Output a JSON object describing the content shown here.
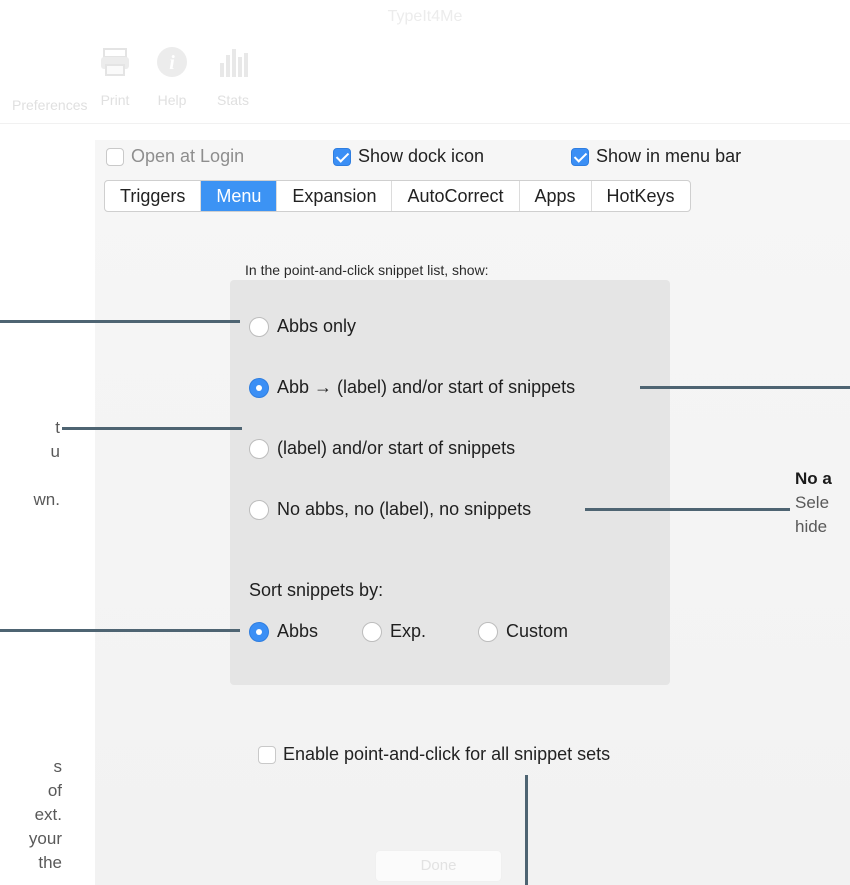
{
  "window": {
    "title": "TypeIt4Me"
  },
  "toolbar": {
    "items": [
      {
        "label": "Preferences",
        "icon": "gear-icon"
      },
      {
        "label": "Print",
        "icon": "printer-icon"
      },
      {
        "label": "Help",
        "icon": "info-icon"
      },
      {
        "label": "Stats",
        "icon": "bar-chart-icon"
      }
    ]
  },
  "options": {
    "open_at_login": {
      "label": "Open at Login",
      "checked": false
    },
    "show_dock_icon": {
      "label": "Show dock icon",
      "checked": true
    },
    "show_in_menu_bar": {
      "label": "Show in menu bar",
      "checked": true
    }
  },
  "tabs": {
    "items": [
      "Triggers",
      "Menu",
      "Expansion",
      "AutoCorrect",
      "Apps",
      "HotKeys"
    ],
    "active": "Menu"
  },
  "menu_pane": {
    "prompt": "In the point-and-click snippet list, show:",
    "display_options": [
      {
        "label": "Abbs only",
        "selected": false
      },
      {
        "label": "Abb → (label) and/or start of snippets",
        "selected": true
      },
      {
        "label": "(label) and/or start of snippets",
        "selected": false
      },
      {
        "label": "No abbs, no (label), no snippets",
        "selected": false
      }
    ],
    "sort_label": "Sort snippets by:",
    "sort_options": [
      {
        "label": "Abbs",
        "selected": true
      },
      {
        "label": "Exp.",
        "selected": false
      },
      {
        "label": "Custom",
        "selected": false
      }
    ],
    "enable_all": {
      "label": "Enable point-and-click for all snippet sets",
      "checked": false
    }
  },
  "annotations": {
    "left_1": [
      "t",
      "u",
      "",
      "wn."
    ],
    "left_2": [
      "s",
      "of",
      "ext.",
      "your",
      "the"
    ],
    "right_title": "No a",
    "right_lines": [
      "Sele",
      "hide"
    ]
  },
  "footer": {
    "done_label": "Done"
  }
}
